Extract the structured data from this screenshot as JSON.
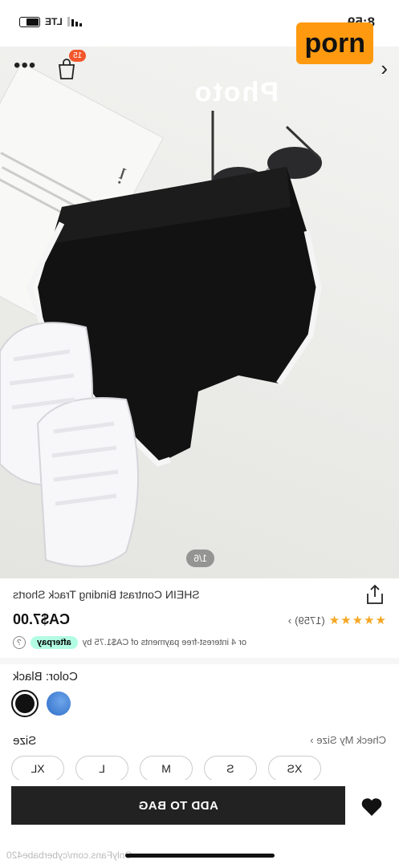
{
  "status_bar": {
    "time": "8:59",
    "network": "LTE"
  },
  "nav": {
    "overlay_text": "Photo",
    "brand_tag": "porn",
    "cart_count": "15"
  },
  "gallery": {
    "counter": "1/6"
  },
  "product": {
    "title": "SHEIN Contrast Binding Track Shorts",
    "price": "CA$7.00",
    "stars": "★★★★★",
    "review_count": "(1759)",
    "afterpay_text": "or 4 interest-free payments of CA$1.75 by",
    "afterpay_brand": "afterpay",
    "info_glyph": "?"
  },
  "color": {
    "label": "Color: Black",
    "options": [
      "Black",
      "Blue"
    ],
    "selected": "Black"
  },
  "size": {
    "label": "Size",
    "check_link": "Check My Size",
    "options": [
      "XS",
      "S",
      "M",
      "L",
      "XL"
    ]
  },
  "footer": {
    "add_to_bag": "ADD TO BAG",
    "watermark": "OnlyFans.com/cyberbabe420"
  },
  "colors": {
    "accent": "#ff9a10",
    "badge": "#f2562a",
    "afterpay": "#b2fce4",
    "button": "#222222",
    "stars": "#f5a623"
  }
}
